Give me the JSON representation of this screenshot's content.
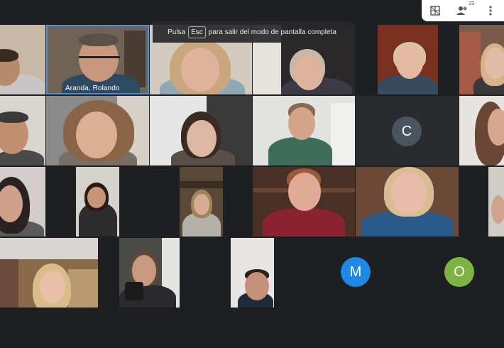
{
  "toast": {
    "prefix": "Pulsa",
    "key": "Esc",
    "suffix": "para salir del modo de pantalla completa"
  },
  "topbar": {
    "grid_icon": "grid-view-icon",
    "people_icon": "participants-icon",
    "participant_count": "23",
    "more_icon": "more-vert-icon"
  },
  "participants": [
    {
      "name": "Aranda, Rolando"
    }
  ],
  "avatars": [
    {
      "initial": "C",
      "color": "#4a545e"
    },
    {
      "initial": "M",
      "color": "#1e88e5"
    },
    {
      "initial": "O",
      "color": "#7cb342"
    }
  ]
}
